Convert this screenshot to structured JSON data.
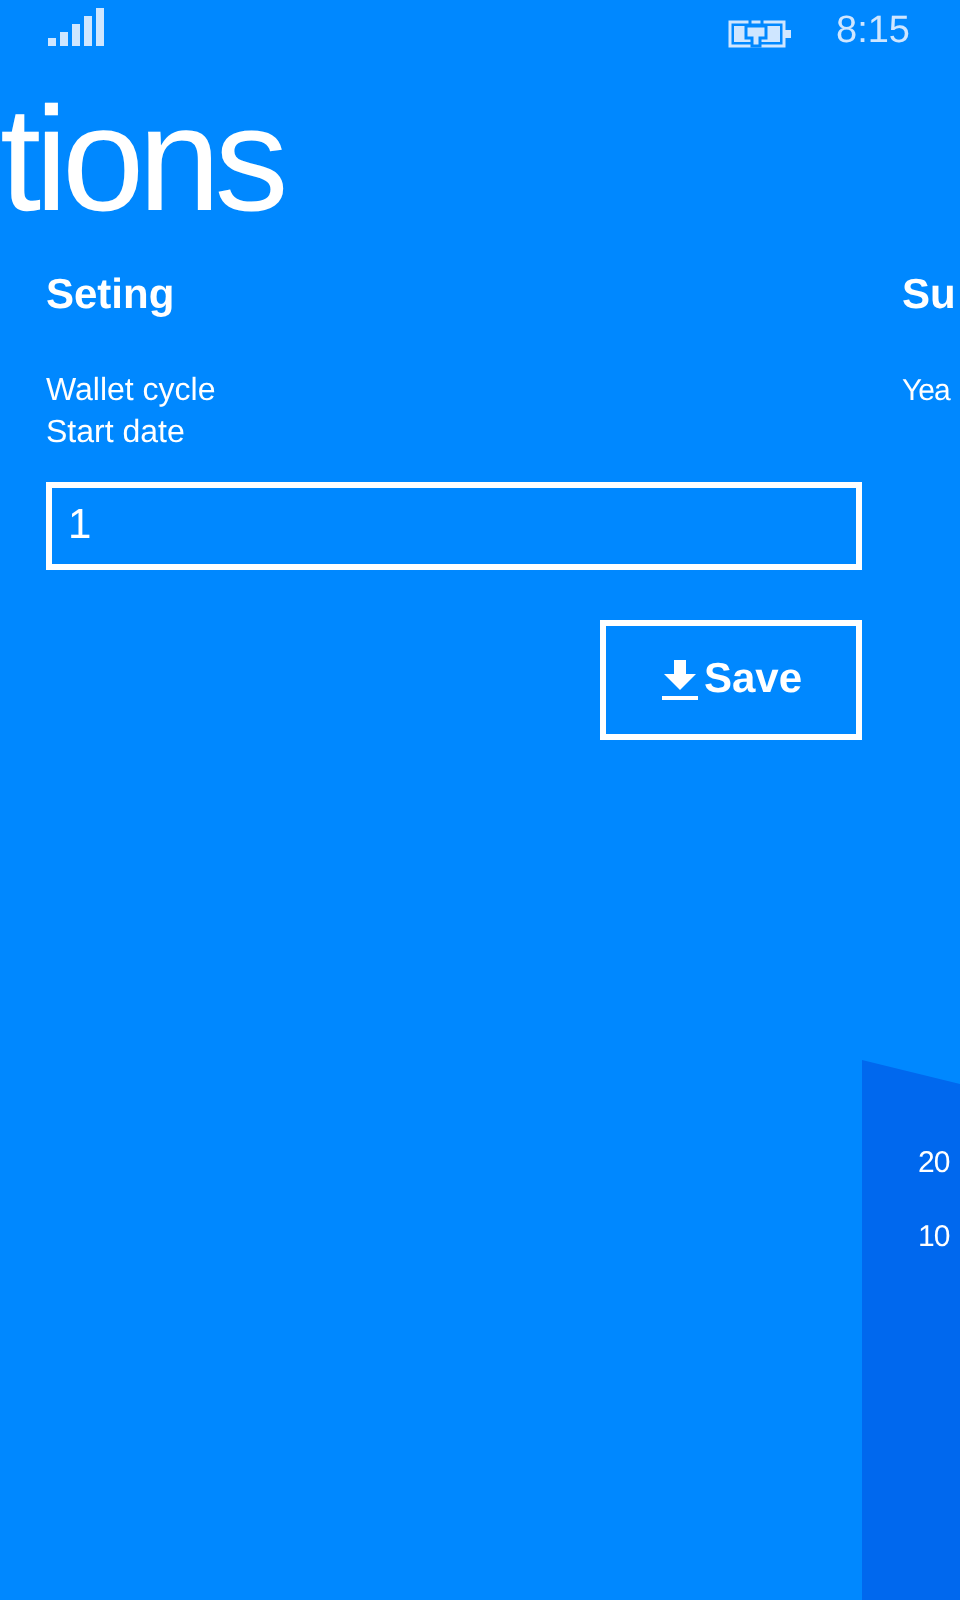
{
  "status_bar": {
    "time": "8:15"
  },
  "page_title": "tions",
  "settings": {
    "heading": "Seting",
    "field_label": "Wallet cycle Start date",
    "field_value": "1",
    "save_button": "Save"
  },
  "summary": {
    "heading": "Su",
    "label": "Yea",
    "panel_values": [
      "20",
      "10"
    ]
  }
}
